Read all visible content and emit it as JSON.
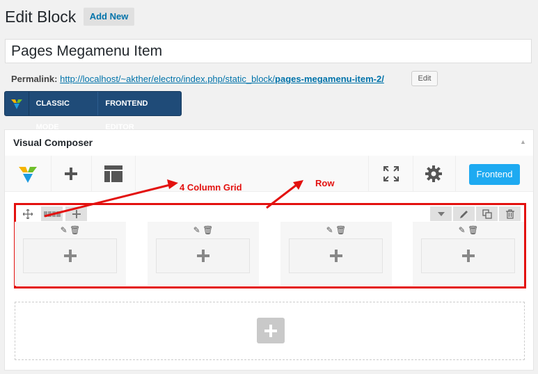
{
  "header": {
    "title": "Edit Block",
    "add_new_label": "Add New"
  },
  "post_title": {
    "value": "Pages Megamenu Item"
  },
  "permalink": {
    "label": "Permalink:",
    "url_base": "http://localhost/~akther/electro/index.php/static_block/",
    "slug": "pages-megamenu-item-2/",
    "edit_label": "Edit"
  },
  "mode_bar": {
    "classic_label": "CLASSIC MODE",
    "frontend_label": "FRONTEND EDITOR"
  },
  "composer": {
    "title": "Visual Composer",
    "frontend_label": "Frontend",
    "accent_color": "#1eaaf1"
  },
  "annotations": {
    "grid_label": "4 Column Grid",
    "row_label": "Row",
    "color": "#e3110f"
  },
  "row": {
    "column_count": 4
  }
}
